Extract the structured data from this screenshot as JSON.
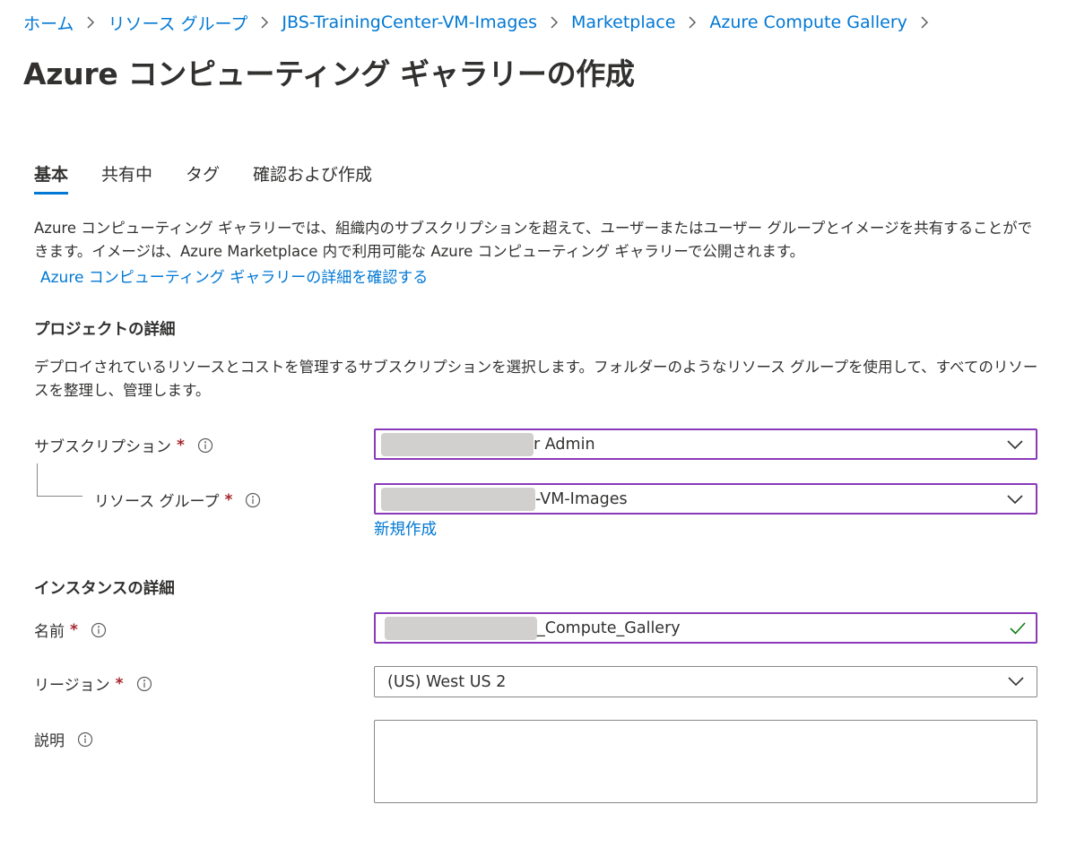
{
  "breadcrumb": [
    "ホーム",
    "リソース グループ",
    "JBS-TrainingCenter-VM-Images",
    "Marketplace",
    "Azure Compute Gallery"
  ],
  "page_title": "Azure コンピューティング ギャラリーの作成",
  "more_label": "···",
  "tabs": [
    {
      "label": "基本",
      "active": true
    },
    {
      "label": "共有中",
      "active": false
    },
    {
      "label": "タグ",
      "active": false
    },
    {
      "label": "確認および作成",
      "active": false
    }
  ],
  "intro": {
    "text": "Azure コンピューティング ギャラリーでは、組織内のサブスクリプションを超えて、ユーザーまたはユーザー グループとイメージを共有することができます。イメージは、Azure Marketplace 内で利用可能な Azure コンピューティング ギャラリーで公開されます。",
    "link": "Azure コンピューティング ギャラリーの詳細を確認する"
  },
  "project": {
    "heading": "プロジェクトの詳細",
    "text": "デプロイされているリソースとコストを管理するサブスクリプションを選択します。フォルダーのようなリソース グループを使用して、すべてのリソースを整理し、管理します。",
    "subscription": {
      "label": "サブスクリプション",
      "value": "r Admin"
    },
    "resource_group": {
      "label": "リソース グループ",
      "value": "-VM-Images",
      "create_new": "新規作成"
    }
  },
  "instance": {
    "heading": "インスタンスの詳細",
    "name": {
      "label": "名前",
      "value": "_Compute_Gallery"
    },
    "region": {
      "label": "リージョン",
      "value": "(US) West US 2"
    },
    "description": {
      "label": "説明",
      "value": ""
    }
  },
  "required_mark": "*",
  "colors": {
    "link": "#0078d4",
    "required": "#a4262c",
    "focus_border": "#8a3ab9",
    "valid": "#107c10"
  },
  "icons": {
    "info": "info-icon",
    "chevron": "chevron-down-icon",
    "check": "checkmark-icon",
    "separator": "chevron-right-icon"
  }
}
